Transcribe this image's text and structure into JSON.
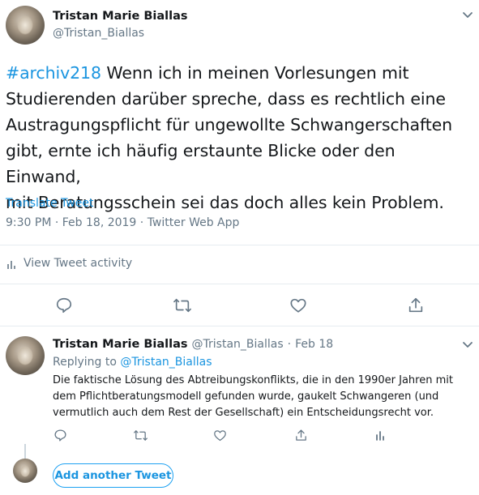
{
  "main_tweet": {
    "author_name": "Tristan Marie Biallas",
    "author_handle": "@Tristan_Biallas",
    "hashtag": "#archiv218",
    "text_line1": " Wenn ich in meinen Vorlesungen mit",
    "text_line2": "Studierenden darüber spreche, dass es rechtlich eine",
    "text_line3": "Austragungspflicht für ungewollte Schwangerschaften",
    "text_line4": "gibt, ernte ich häufig erstaunte Blicke oder den Einwand,",
    "text_line5": "mit Beratungsschein sei das doch alles kein Problem.",
    "translate_label": "Translate Tweet",
    "timestamp": "9:30 PM · Feb 18, 2019 · Twitter Web App",
    "activity_label": "View Tweet activity"
  },
  "reply_tweet": {
    "author_name": "Tristan Marie Biallas",
    "author_handle": "@Tristan_Biallas",
    "separator": "·",
    "date": "Feb 18",
    "replying_prefix": "Replying to ",
    "replying_handle": "@Tristan_Biallas",
    "text_line1": "Die faktische Lösung des Abtreibungskonflikts, die in den 1990er Jahren mit",
    "text_line2": "dem Pflichtberatungsmodell gefunden wurde, gaukelt Schwangeren (und",
    "text_line3": "vermutlich auch dem Rest der Gesellschaft) ein Entscheidungsrecht vor."
  },
  "composer": {
    "add_button_label": "Add another Tweet"
  },
  "icons": [
    "chevron-down-icon",
    "bar-chart-icon",
    "reply-icon",
    "retweet-icon",
    "like-icon",
    "share-icon"
  ],
  "colors": {
    "accent": "#1da1f2",
    "link": "#1b95e0",
    "muted": "#657786",
    "divider": "#e6ecf0"
  }
}
